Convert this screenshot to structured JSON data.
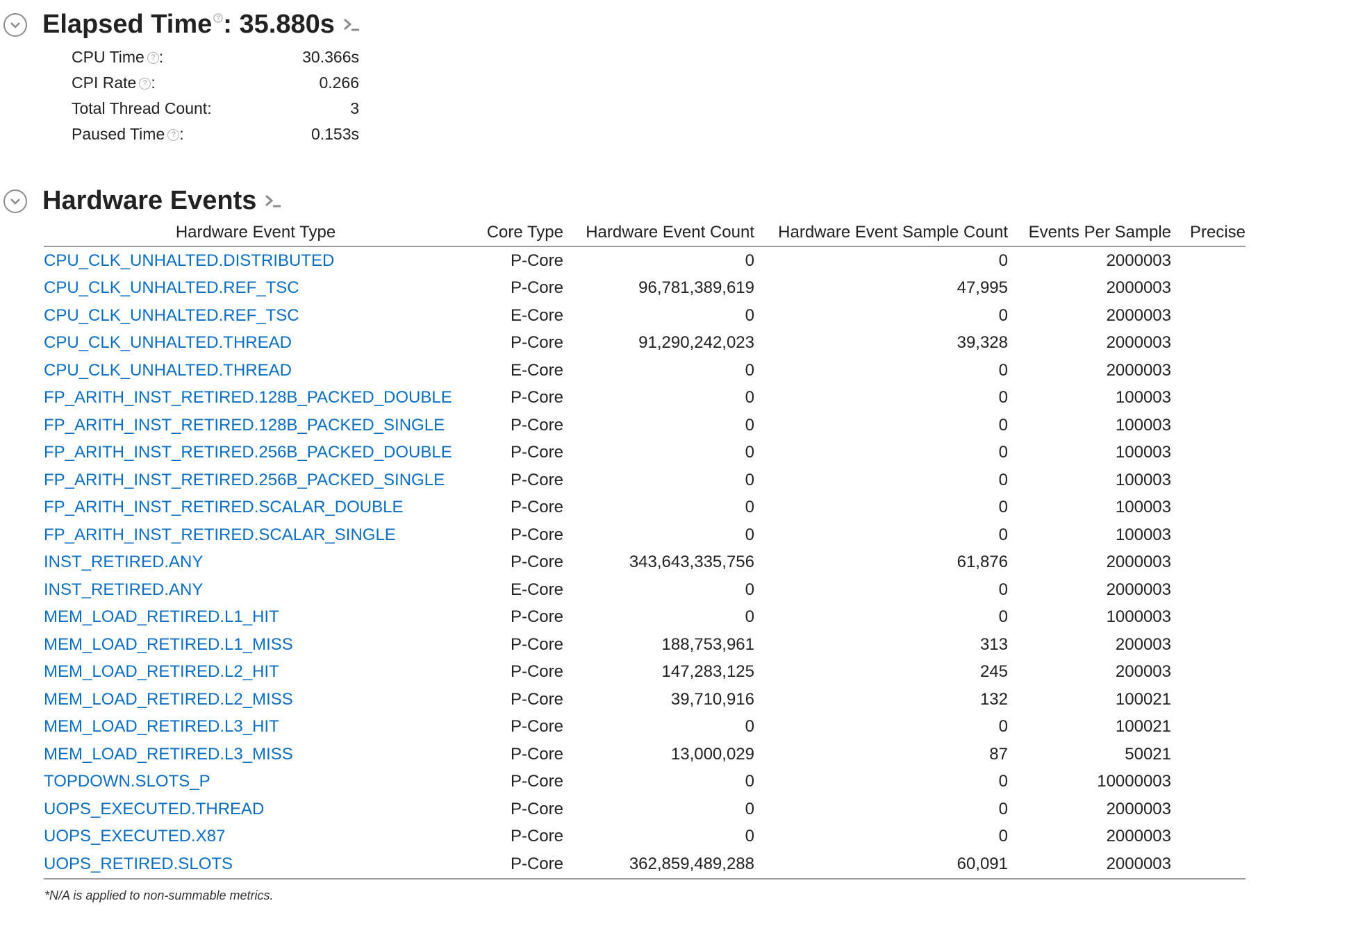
{
  "elapsed": {
    "title": "Elapsed Time",
    "help_glyph": "?",
    "value_text": ": 35.880s",
    "metrics": [
      {
        "label": "CPU Time",
        "has_help": true,
        "suffix": ":",
        "value": "30.366s"
      },
      {
        "label": "CPI Rate",
        "has_help": true,
        "suffix": ":",
        "value": "0.266"
      },
      {
        "label": "Total Thread Count:",
        "has_help": false,
        "suffix": "",
        "value": "3"
      },
      {
        "label": "Paused Time",
        "has_help": true,
        "suffix": ":",
        "value": "0.153s"
      }
    ]
  },
  "hardware_events": {
    "title": "Hardware Events",
    "columns": [
      "Hardware Event Type",
      "Core Type",
      "Hardware Event Count",
      "Hardware Event Sample Count",
      "Events Per Sample",
      "Precise"
    ],
    "rows": [
      {
        "type": "CPU_CLK_UNHALTED.DISTRIBUTED",
        "core": "P-Core",
        "count": "0",
        "sample_count": "0",
        "per_sample": "2000003",
        "precise": ""
      },
      {
        "type": "CPU_CLK_UNHALTED.REF_TSC",
        "core": "P-Core",
        "count": "96,781,389,619",
        "sample_count": "47,995",
        "per_sample": "2000003",
        "precise": ""
      },
      {
        "type": "CPU_CLK_UNHALTED.REF_TSC",
        "core": "E-Core",
        "count": "0",
        "sample_count": "0",
        "per_sample": "2000003",
        "precise": ""
      },
      {
        "type": "CPU_CLK_UNHALTED.THREAD",
        "core": "P-Core",
        "count": "91,290,242,023",
        "sample_count": "39,328",
        "per_sample": "2000003",
        "precise": ""
      },
      {
        "type": "CPU_CLK_UNHALTED.THREAD",
        "core": "E-Core",
        "count": "0",
        "sample_count": "0",
        "per_sample": "2000003",
        "precise": ""
      },
      {
        "type": "FP_ARITH_INST_RETIRED.128B_PACKED_DOUBLE",
        "core": "P-Core",
        "count": "0",
        "sample_count": "0",
        "per_sample": "100003",
        "precise": ""
      },
      {
        "type": "FP_ARITH_INST_RETIRED.128B_PACKED_SINGLE",
        "core": "P-Core",
        "count": "0",
        "sample_count": "0",
        "per_sample": "100003",
        "precise": ""
      },
      {
        "type": "FP_ARITH_INST_RETIRED.256B_PACKED_DOUBLE",
        "core": "P-Core",
        "count": "0",
        "sample_count": "0",
        "per_sample": "100003",
        "precise": ""
      },
      {
        "type": "FP_ARITH_INST_RETIRED.256B_PACKED_SINGLE",
        "core": "P-Core",
        "count": "0",
        "sample_count": "0",
        "per_sample": "100003",
        "precise": ""
      },
      {
        "type": "FP_ARITH_INST_RETIRED.SCALAR_DOUBLE",
        "core": "P-Core",
        "count": "0",
        "sample_count": "0",
        "per_sample": "100003",
        "precise": ""
      },
      {
        "type": "FP_ARITH_INST_RETIRED.SCALAR_SINGLE",
        "core": "P-Core",
        "count": "0",
        "sample_count": "0",
        "per_sample": "100003",
        "precise": ""
      },
      {
        "type": "INST_RETIRED.ANY",
        "core": "P-Core",
        "count": "343,643,335,756",
        "sample_count": "61,876",
        "per_sample": "2000003",
        "precise": ""
      },
      {
        "type": "INST_RETIRED.ANY",
        "core": "E-Core",
        "count": "0",
        "sample_count": "0",
        "per_sample": "2000003",
        "precise": ""
      },
      {
        "type": "MEM_LOAD_RETIRED.L1_HIT",
        "core": "P-Core",
        "count": "0",
        "sample_count": "0",
        "per_sample": "1000003",
        "precise": ""
      },
      {
        "type": "MEM_LOAD_RETIRED.L1_MISS",
        "core": "P-Core",
        "count": "188,753,961",
        "sample_count": "313",
        "per_sample": "200003",
        "precise": ""
      },
      {
        "type": "MEM_LOAD_RETIRED.L2_HIT",
        "core": "P-Core",
        "count": "147,283,125",
        "sample_count": "245",
        "per_sample": "200003",
        "precise": ""
      },
      {
        "type": "MEM_LOAD_RETIRED.L2_MISS",
        "core": "P-Core",
        "count": "39,710,916",
        "sample_count": "132",
        "per_sample": "100021",
        "precise": ""
      },
      {
        "type": "MEM_LOAD_RETIRED.L3_HIT",
        "core": "P-Core",
        "count": "0",
        "sample_count": "0",
        "per_sample": "100021",
        "precise": ""
      },
      {
        "type": "MEM_LOAD_RETIRED.L3_MISS",
        "core": "P-Core",
        "count": "13,000,029",
        "sample_count": "87",
        "per_sample": "50021",
        "precise": ""
      },
      {
        "type": "TOPDOWN.SLOTS_P",
        "core": "P-Core",
        "count": "0",
        "sample_count": "0",
        "per_sample": "10000003",
        "precise": ""
      },
      {
        "type": "UOPS_EXECUTED.THREAD",
        "core": "P-Core",
        "count": "0",
        "sample_count": "0",
        "per_sample": "2000003",
        "precise": ""
      },
      {
        "type": "UOPS_EXECUTED.X87",
        "core": "P-Core",
        "count": "0",
        "sample_count": "0",
        "per_sample": "2000003",
        "precise": ""
      },
      {
        "type": "UOPS_RETIRED.SLOTS",
        "core": "P-Core",
        "count": "362,859,489,288",
        "sample_count": "60,091",
        "per_sample": "2000003",
        "precise": ""
      }
    ]
  },
  "footnote": "*N/A is applied to non-summable metrics.",
  "colors": {
    "link": "#0b6ec2",
    "text": "#222222",
    "icon": "#8c8c8c",
    "rule": "#9a9a9a"
  }
}
